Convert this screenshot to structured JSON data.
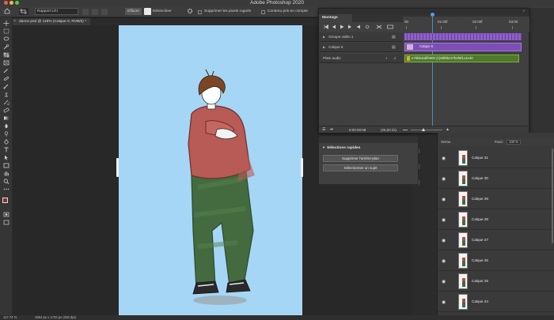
{
  "app": {
    "title": "Adobe Photoshop 2020"
  },
  "options": {
    "mode_select": "Rapport L/H",
    "clear_button": "Effacer",
    "straighten_label": "Désincliner",
    "delete_cropped": "Supprimer les pixels rognés",
    "content_aware": "Contenu pris en compte"
  },
  "document": {
    "tab_label": "dance.psd @ 118% (Calque 0, RVB/8) *"
  },
  "statusbar": {
    "zoom": "117,74 %",
    "size": "1654 px x 1733 px (330 dpi)"
  },
  "timeline": {
    "tab": "Montage",
    "ruler": [
      "00",
      "01:00f",
      "02:00f",
      "03:00"
    ],
    "tracks": [
      {
        "label": "Groupe vidéo 1"
      },
      {
        "label": "Calque 5",
        "clip": "Calque 5"
      },
      {
        "label": "Piste audio",
        "clip": "e70bb4abf0600 (1)6bf8bc27b2f6f1c4e40"
      }
    ],
    "timecode": "0:00:00:08",
    "fps": "(25,00 i/s)"
  },
  "quick_select": {
    "title": "Sélections rapides",
    "remove_bg": "Supprimer l'arrière-plan",
    "select_subject": "Sélectionner un sujet"
  },
  "layers": {
    "blend": "Verrou",
    "fill_label": "Fond :",
    "fill_value": "100 %",
    "items": [
      {
        "name": "Calque 31"
      },
      {
        "name": "Calque 30"
      },
      {
        "name": "Calque 29"
      },
      {
        "name": "Calque 28"
      },
      {
        "name": "Calque 27"
      },
      {
        "name": "Calque 26"
      },
      {
        "name": "Calque 25"
      },
      {
        "name": "Calque 24"
      }
    ]
  },
  "colors": {
    "canvas_bg": "#a6d6f6",
    "clip_purple": "#7e4eb8",
    "clip_audio": "#4e7b2a",
    "playhead": "#4e9ee6"
  }
}
